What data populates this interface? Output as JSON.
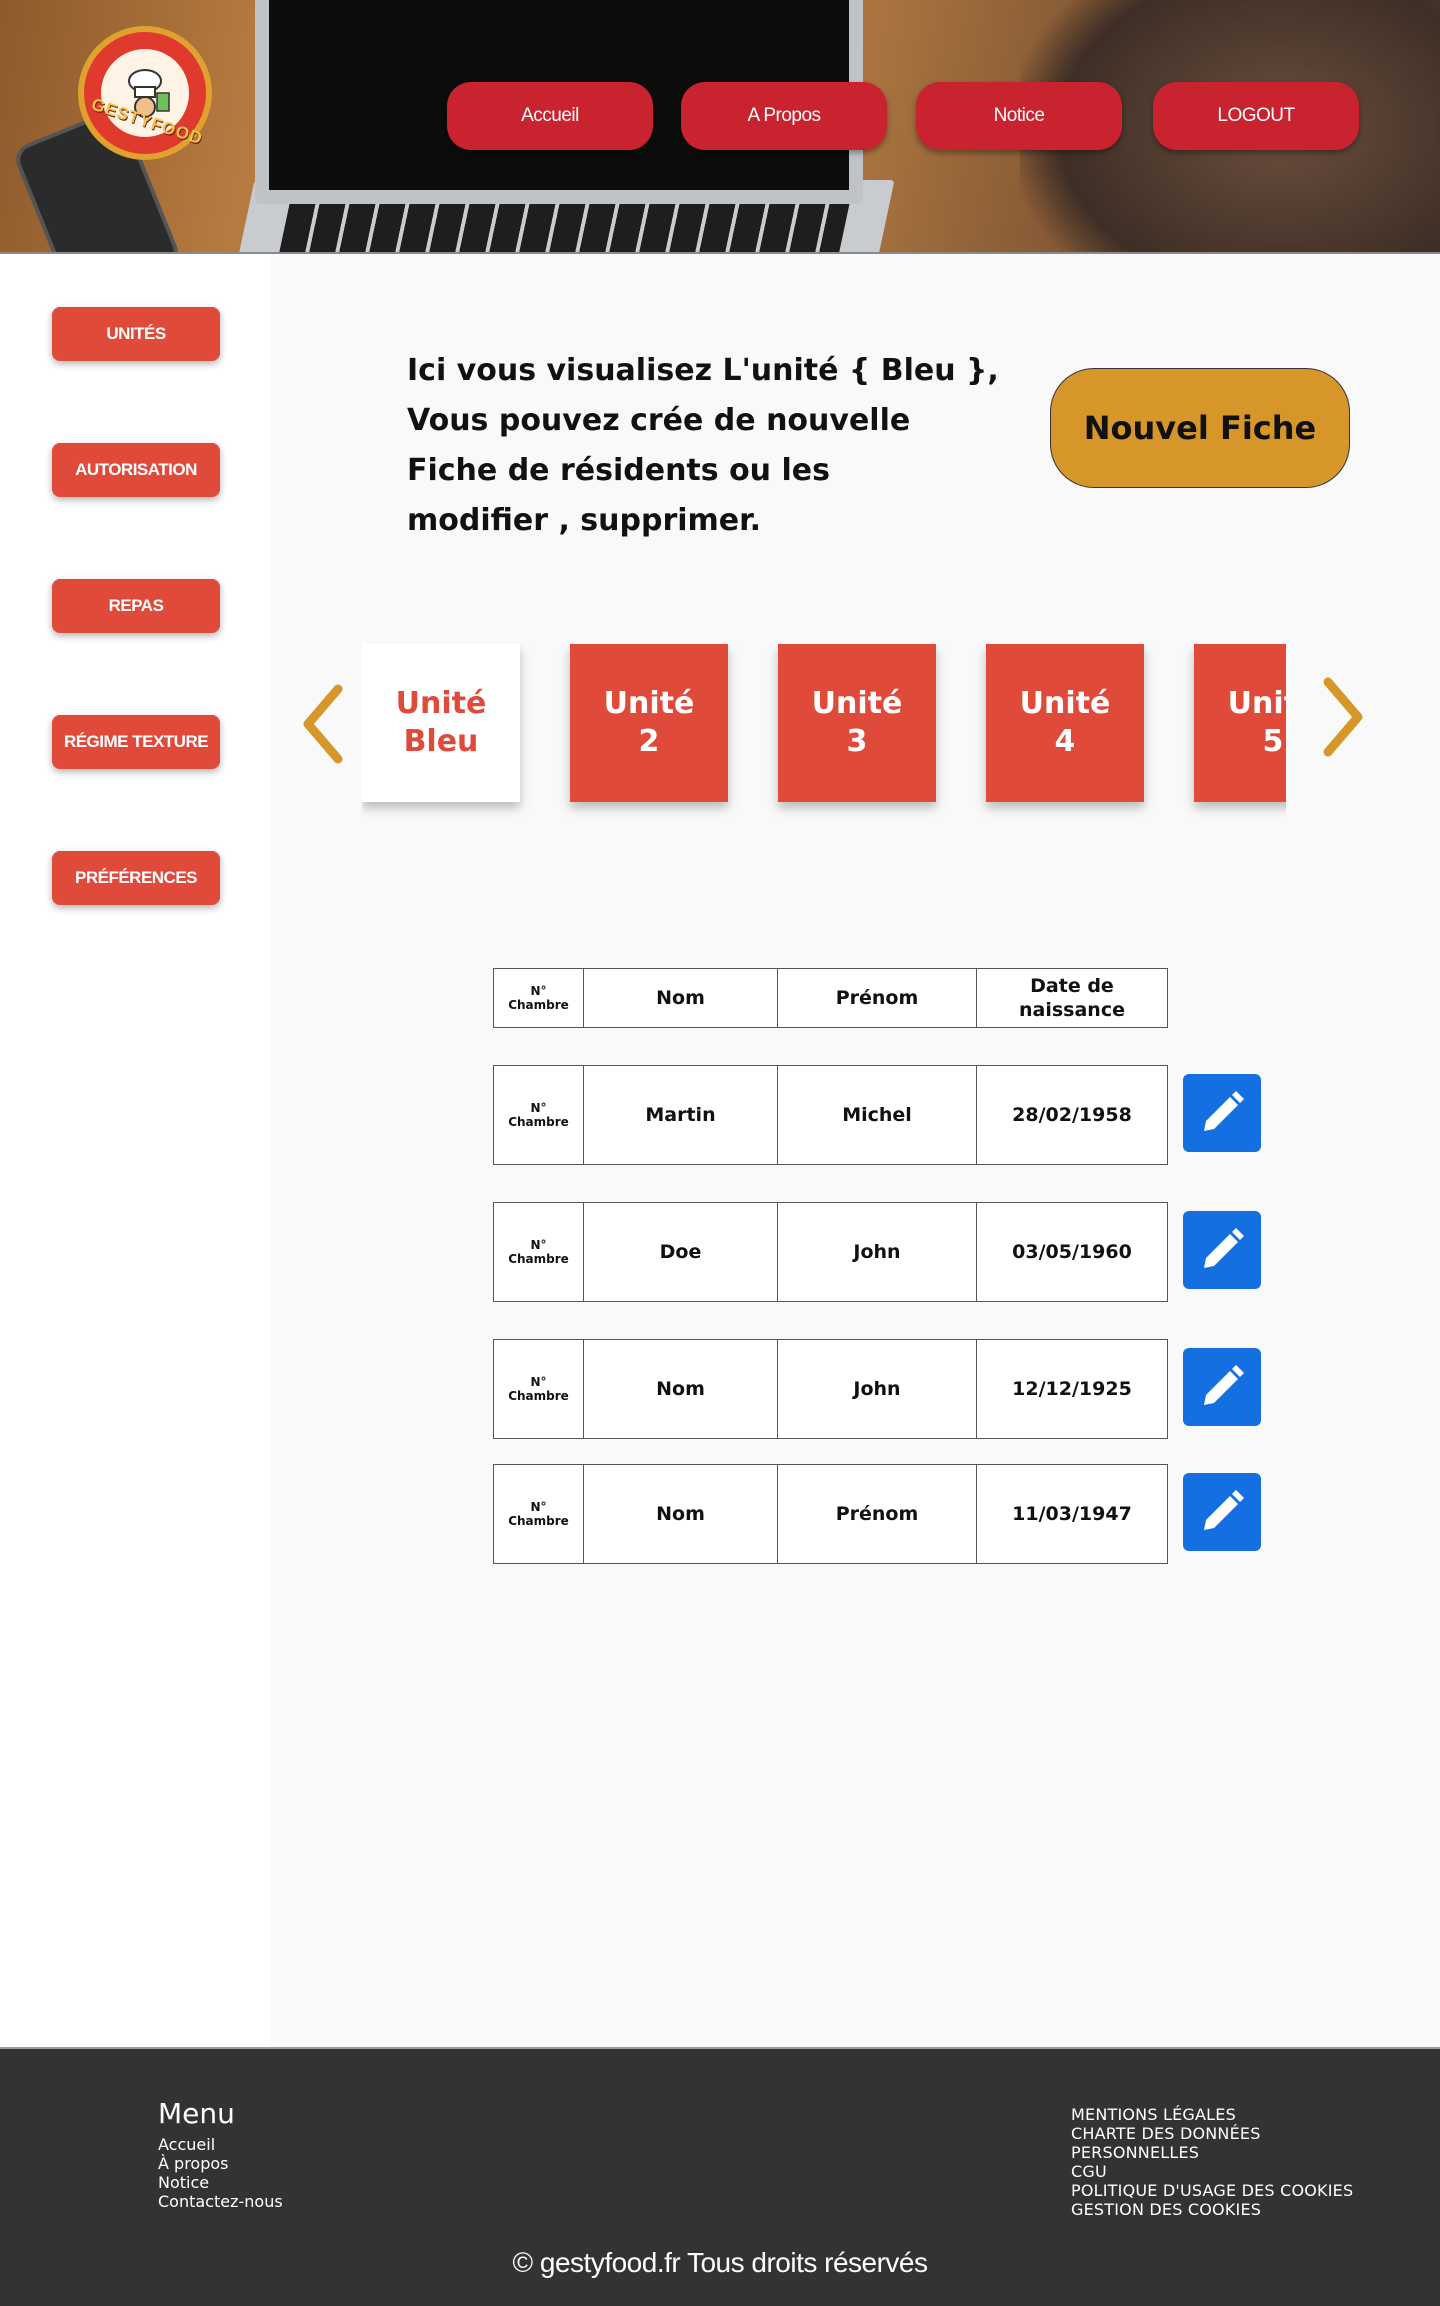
{
  "header": {
    "logo_text": "GESTYFOOD",
    "nav": [
      "Accueil",
      "A Propos",
      "Notice",
      "LOGOUT"
    ]
  },
  "sidebar": {
    "items": [
      "UNITÉS",
      "AUTORISATION",
      "REPAS",
      "RÉGIME TEXTURE",
      "PRÉFÉRENCES"
    ]
  },
  "main": {
    "intro_lines": [
      "Ici vous  visualisez L'unité { Bleu },",
      "Vous pouvez crée de nouvelle",
      "Fiche de résidents ou les",
      "modifier  , supprimer."
    ],
    "new_button": "Nouvel Fiche",
    "units": [
      {
        "l1": "Unité",
        "l2": "Bleu",
        "active": true
      },
      {
        "l1": "Unité",
        "l2": "2",
        "active": false
      },
      {
        "l1": "Unité",
        "l2": "3",
        "active": false
      },
      {
        "l1": "Unité",
        "l2": "4",
        "active": false
      },
      {
        "l1": "Unité",
        "l2": "5",
        "active": false
      }
    ]
  },
  "table": {
    "headers": {
      "chambre_1": "N°",
      "chambre_2": "Chambre",
      "nom": "Nom",
      "prenom": "Prénom",
      "date_1": "Date de",
      "date_2": "naissance"
    },
    "rows": [
      {
        "ch1": "N°",
        "ch2": "Chambre",
        "nom": "Martin",
        "prenom": "Michel",
        "date": "28/02/1958"
      },
      {
        "ch1": "N°",
        "ch2": "Chambre",
        "nom": "Doe",
        "prenom": "John",
        "date": "03/05/1960"
      },
      {
        "ch1": "N°",
        "ch2": "Chambre",
        "nom": "Nom",
        "prenom": "John",
        "date": "12/12/1925"
      },
      {
        "ch1": "N°",
        "ch2": "Chambre",
        "nom": "Nom",
        "prenom": "Prénom",
        "date": "11/03/1947"
      }
    ]
  },
  "footer": {
    "menu_title": "Menu",
    "menu_links": [
      "Accueil",
      "À propos",
      "Notice",
      "Contactez-nous"
    ],
    "legal_links": [
      "MENTIONS LÉGALES",
      "CHARTE DES DONNÉES",
      "PERSONNELLES",
      "CGU",
      "POLITIQUE D'USAGE DES COOKIES",
      "GESTION DES COOKIES"
    ],
    "copyright": "© gestyfood.fr  Tous droits réservés"
  },
  "colors": {
    "accent_red": "#e04a3b",
    "nav_red": "#c92330",
    "gold": "#d6962a",
    "edit_blue": "#1470e0",
    "footer_bg": "#333333"
  },
  "icons": [
    "chevron-left-icon",
    "chevron-right-icon",
    "pencil-icon",
    "chef-logo-icon"
  ]
}
